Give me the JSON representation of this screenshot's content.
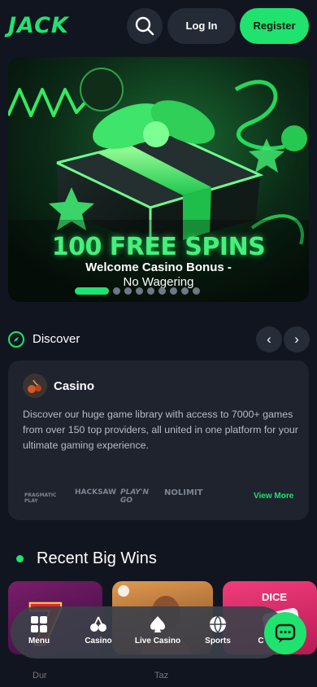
{
  "header": {
    "logo": "JACK",
    "login_label": "Log In",
    "register_label": "Register"
  },
  "banner": {
    "headline": "100 FREE SPINS",
    "subline1": "Welcome Casino Bonus -",
    "subline2": "No Wagering",
    "slides_total": 9,
    "active_slide": 1
  },
  "discover": {
    "label": "Discover",
    "prev": "‹",
    "next": "›"
  },
  "casino_card": {
    "title": "Casino",
    "description": "Discover our huge game library with access to 7000+ games from over 150 top providers, all united in one platform for your ultimate gaming experience.",
    "providers": [
      "PRAGMATIC PLAY",
      "HACKSAW",
      "PLAY'N GO",
      "NOLIMIT"
    ],
    "view_more": "View More"
  },
  "recent_wins": {
    "title": "Recent Big Wins",
    "games": [
      {
        "tag": "Dur"
      },
      {
        "tag": "Taz"
      },
      {
        "tag": "DICE",
        "label": "DICE"
      }
    ]
  },
  "bottom_nav": {
    "items": [
      {
        "label": "Menu",
        "icon": "grid-icon"
      },
      {
        "label": "Casino",
        "icon": "cherries-icon"
      },
      {
        "label": "Live Casino",
        "icon": "spade-icon"
      },
      {
        "label": "Sports",
        "icon": "ball-icon"
      },
      {
        "label": "C",
        "icon": "chat-icon"
      }
    ]
  },
  "colors": {
    "accent": "#1fe36e",
    "background": "#11151f",
    "card": "#1e232e"
  }
}
